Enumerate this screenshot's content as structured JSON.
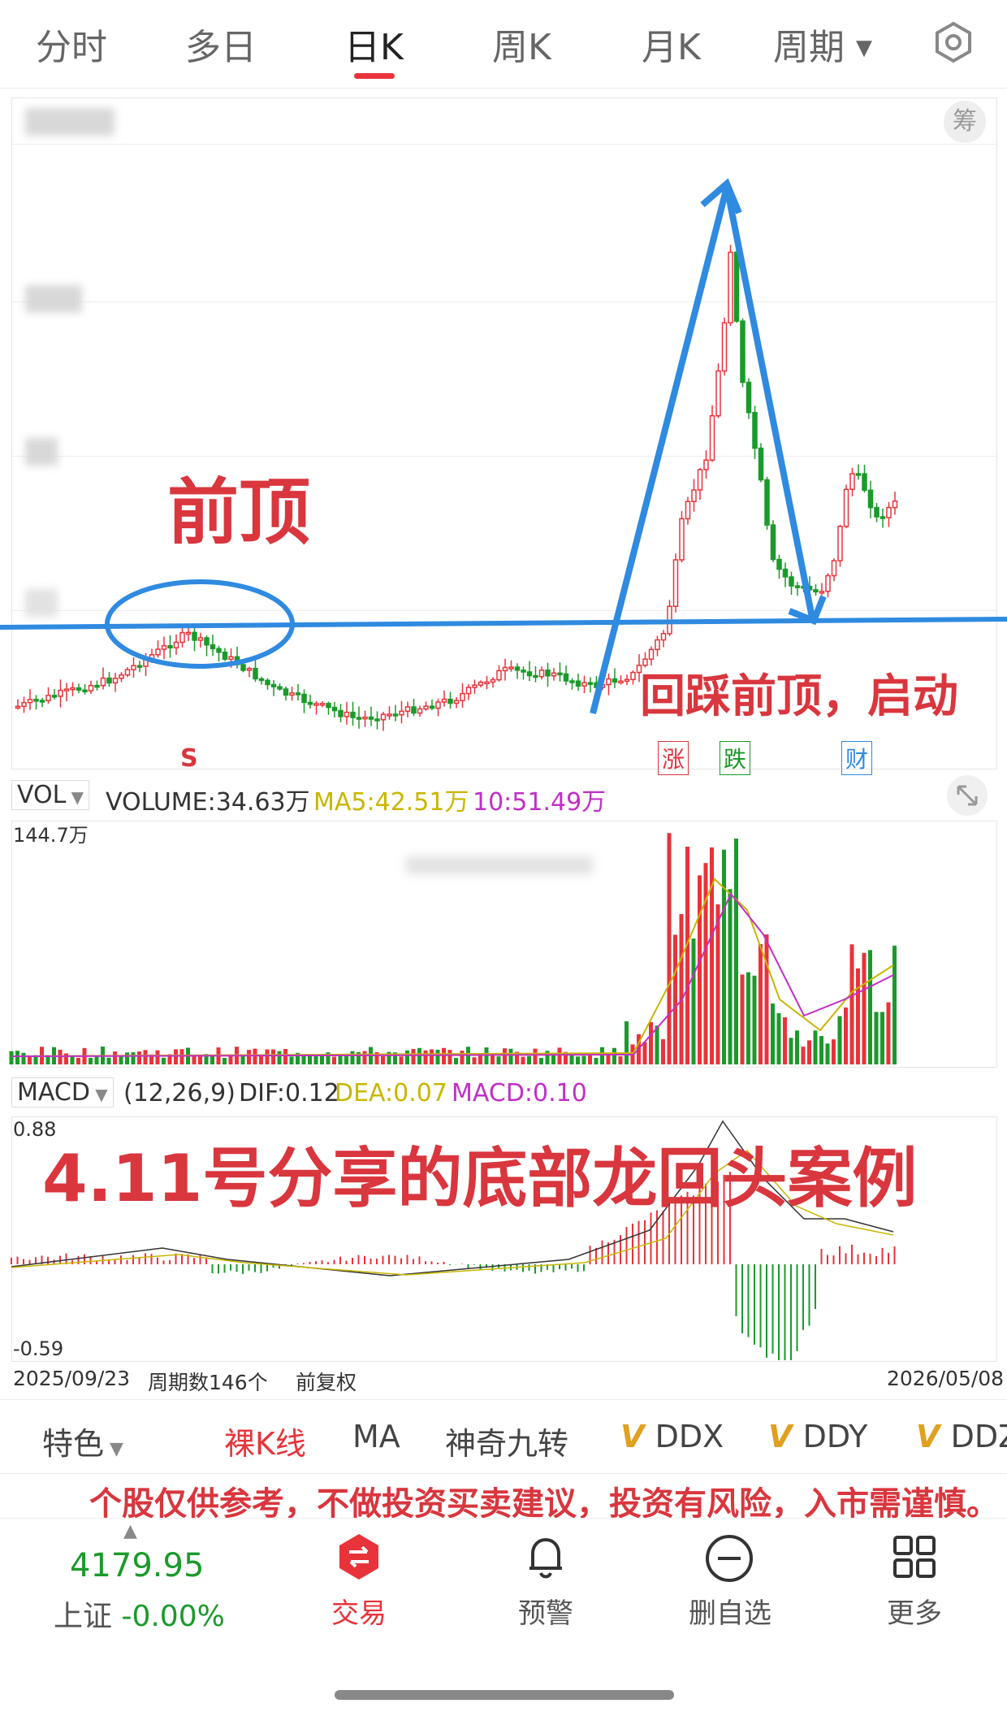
{
  "tabs": [
    "分时",
    "多日",
    "日K",
    "周K",
    "月K",
    "周期"
  ],
  "active_tab": "日K",
  "chart_badge": "筹",
  "annotations": {
    "prev_top": "前顶",
    "retest": "回踩前顶，启动",
    "title": "4.11号分享的底部龙回头案例",
    "signal_s": "S",
    "tag_rise": "涨",
    "tag_fall": "跌",
    "tag_fin": "财"
  },
  "vol": {
    "label": "VOL",
    "volume": "VOLUME:34.63万",
    "ma5": "MA5:42.51万",
    "ma10": "10:51.49万",
    "max": "144.7万",
    "ma5_color": "#c9b600",
    "ma10_color": "#c22fc6"
  },
  "macd": {
    "label": "MACD",
    "params": "(12,26,9)",
    "dif": "DIF:0.12",
    "dea": "DEA:0.07",
    "macd": "MACD:0.10",
    "max": "0.88",
    "min": "-0.59"
  },
  "axis": {
    "start": "2025/09/23",
    "periods": "周期数146个",
    "adjust": "前复权",
    "end": "2026/05/08"
  },
  "toolbar": [
    "特色",
    "裸K线",
    "MA",
    "神奇九转",
    "DDX",
    "DDY",
    "DDZ"
  ],
  "disclaimer": "个股仅供参考，不做投资买卖建议，投资有风险，入市需谨慎。",
  "index": {
    "value": "4179.95",
    "name": "上证",
    "change": "-0.00%"
  },
  "bottom_nav": [
    "交易",
    "预警",
    "删自选",
    "更多"
  ],
  "colors": {
    "up": "#e8333a",
    "down": "#1a9a2a",
    "annotation_blue": "#2f8ae0",
    "accent": "#e8333a"
  }
}
